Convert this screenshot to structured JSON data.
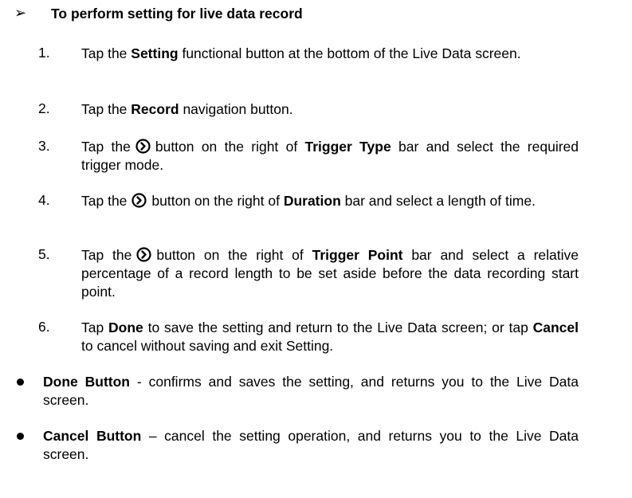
{
  "heading": "To perform setting for live data record",
  "steps": [
    {
      "num": "1.",
      "pre": "Tap the ",
      "b": "Setting",
      "post": " functional button at the bottom of the Live Data screen."
    },
    {
      "num": "2.",
      "pre": "Tap the ",
      "b": "Record",
      "post": " navigation button."
    },
    {
      "num": "3.",
      "pre": "Tap the",
      "mid": "button on the right of ",
      "b": "Trigger Type",
      "post": " bar and select the required trigger mode."
    },
    {
      "num": "4.",
      "pre": "Tap the",
      "mid": "button on the right of ",
      "b": "Duration",
      "post": " bar and select a length of time."
    },
    {
      "num": "5.",
      "pre": "Tap the",
      "mid": "button on the right of ",
      "b": "Trigger Point",
      "post": " bar and select a relative percentage of a record length to be set aside before the data recording start point."
    },
    {
      "num": "6.",
      "pre": "Tap ",
      "b": "Done",
      "mid": " to save the setting and return to the Live Data screen; or tap ",
      "b2": "Cancel",
      "post": " to cancel without saving and exit Setting."
    }
  ],
  "bullets": [
    {
      "b": "Done Button",
      "post": " - confirms and saves the setting, and returns you to the Live Data screen."
    },
    {
      "b": "Cancel Button",
      "post": " – cancel the setting operation, and returns you to the Live Data screen."
    }
  ],
  "icons": {
    "arrow": "arrow-bullet-icon",
    "next": "circle-chevron-right-icon"
  }
}
